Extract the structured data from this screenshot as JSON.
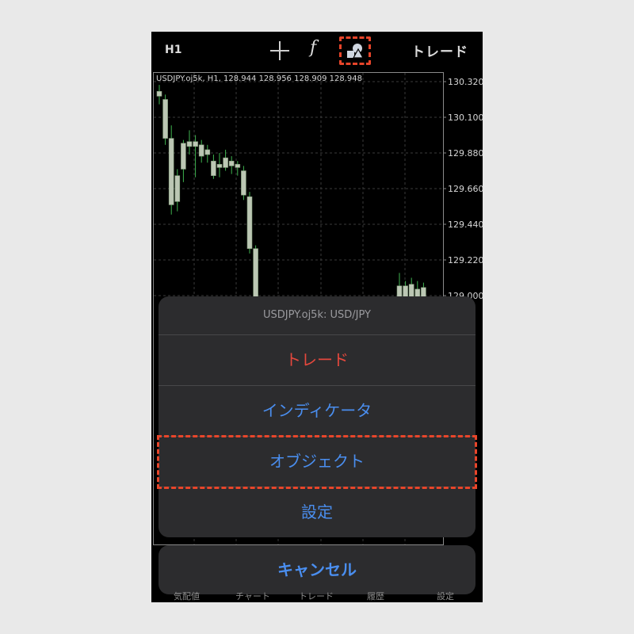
{
  "topbar": {
    "timeframe": "H1",
    "crosshair_icon": "crosshair-icon",
    "function_label": "f",
    "objects_icon": "shapes-icon",
    "trade_label": "トレード"
  },
  "chart": {
    "info": "USDJPY.oj5k, H1, 128.944 128.956 128.909 128.948",
    "price_labels": [
      "130.320",
      "130.100",
      "129.880",
      "129.660",
      "129.440",
      "129.220",
      "129.000"
    ],
    "bear_color": "#bcc7b4",
    "bull_color": "#bcc7b4",
    "wick_color": "#3fb34f",
    "grid_color": "#3a3a3a",
    "candles": [
      {
        "o": 130.23,
        "h": 130.3,
        "l": 130.18,
        "c": 130.26
      },
      {
        "o": 130.21,
        "h": 130.24,
        "l": 129.93,
        "c": 129.97
      },
      {
        "o": 129.97,
        "h": 130.05,
        "l": 129.5,
        "c": 129.56
      },
      {
        "o": 129.58,
        "h": 129.78,
        "l": 129.52,
        "c": 129.74
      },
      {
        "o": 129.78,
        "h": 129.96,
        "l": 129.7,
        "c": 129.94
      },
      {
        "o": 129.95,
        "h": 130.02,
        "l": 129.87,
        "c": 129.92
      },
      {
        "o": 129.92,
        "h": 129.99,
        "l": 129.73,
        "c": 129.95
      },
      {
        "o": 129.93,
        "h": 129.96,
        "l": 129.82,
        "c": 129.86
      },
      {
        "o": 129.87,
        "h": 129.93,
        "l": 129.82,
        "c": 129.9
      },
      {
        "o": 129.83,
        "h": 129.87,
        "l": 129.72,
        "c": 129.74
      },
      {
        "o": 129.79,
        "h": 129.88,
        "l": 129.73,
        "c": 129.81
      },
      {
        "o": 129.85,
        "h": 129.9,
        "l": 129.77,
        "c": 129.79
      },
      {
        "o": 129.8,
        "h": 129.86,
        "l": 129.75,
        "c": 129.83
      },
      {
        "o": 129.81,
        "h": 129.83,
        "l": 129.74,
        "c": 129.79
      },
      {
        "o": 129.77,
        "h": 129.8,
        "l": 129.59,
        "c": 129.62
      },
      {
        "o": 129.61,
        "h": 129.64,
        "l": 129.26,
        "c": 129.29
      },
      {
        "o": 129.29,
        "h": 129.31,
        "l": 128.9,
        "c": 128.94
      }
    ],
    "right_candles": [
      {
        "o": 128.88,
        "h": 129.14,
        "l": 128.85,
        "c": 129.06
      },
      {
        "o": 129.06,
        "h": 129.09,
        "l": 128.9,
        "c": 128.94
      },
      {
        "o": 128.94,
        "h": 129.11,
        "l": 128.88,
        "c": 129.07
      },
      {
        "o": 129.04,
        "h": 129.09,
        "l": 128.9,
        "c": 128.94
      },
      {
        "o": 128.95,
        "h": 129.08,
        "l": 128.91,
        "c": 129.05
      }
    ]
  },
  "sheet": {
    "title": "USDJPY.oj5k: USD/JPY",
    "items": [
      "トレード",
      "インディケータ",
      "オブジェクト",
      "設定"
    ],
    "cancel": "キャンセル"
  },
  "tabs": [
    "気配値",
    "チャート",
    "トレード",
    "履歴",
    "設定"
  ],
  "colors": {
    "highlight": "#e8452a",
    "sheet_bg": "#2c2c2e",
    "action_blue": "#4a8eef",
    "action_red": "#e5483d"
  }
}
